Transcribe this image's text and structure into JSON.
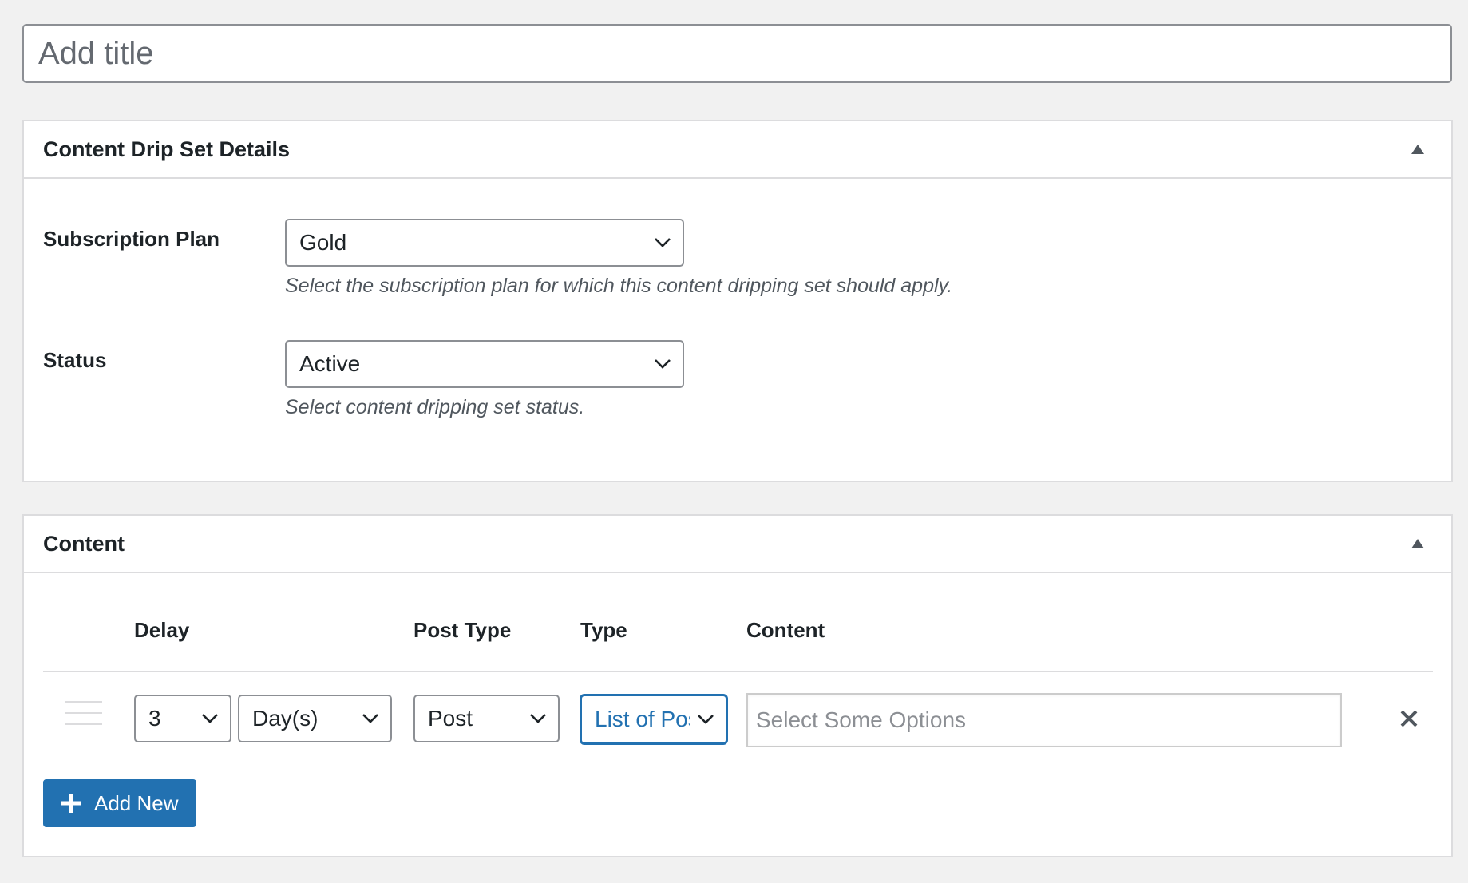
{
  "title": {
    "placeholder": "Add title",
    "value": ""
  },
  "details_box": {
    "heading": "Content Drip Set Details",
    "fields": {
      "subscription_plan": {
        "label": "Subscription Plan",
        "selected": "Gold",
        "description": "Select the subscription plan for which this content dripping set should apply."
      },
      "status": {
        "label": "Status",
        "selected": "Active",
        "description": "Select content dripping set status."
      }
    }
  },
  "content_box": {
    "heading": "Content",
    "columns": {
      "delay": "Delay",
      "post_type": "Post Type",
      "type": "Type",
      "content": "Content"
    },
    "rows": [
      {
        "delay_amount": "3",
        "delay_unit": "Day(s)",
        "post_type": "Post",
        "type": "List of Posts",
        "content_placeholder": "Select Some Options"
      }
    ],
    "add_new_label": "Add New"
  },
  "colors": {
    "accent": "#2271b1",
    "background": "#f1f1f1",
    "border": "#dcdcde",
    "text": "#1d2327",
    "muted": "#50575e"
  },
  "icons": {
    "collapse": "triangle-up-icon",
    "dropdown": "chevron-down-icon",
    "drag": "drag-handle-icon",
    "remove": "close-icon",
    "add": "plus-icon"
  }
}
